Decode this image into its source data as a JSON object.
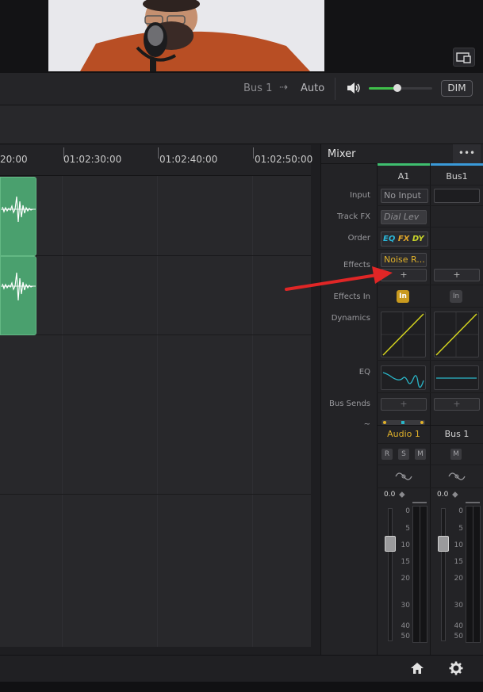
{
  "transport": {
    "bus_label": "Bus 1",
    "arrow": "⇢",
    "auto_label": "Auto",
    "dim_label": "DIM",
    "volume_level": 0.45
  },
  "timeline": {
    "ticks": [
      "20:00",
      "01:02:30:00",
      "01:02:40:00",
      "01:02:50:00"
    ]
  },
  "mixer": {
    "title": "Mixer",
    "menu_label": "•••",
    "row_labels": {
      "input": "Input",
      "track_fx": "Track FX",
      "order": "Order",
      "effects": "Effects",
      "effects_in": "Effects In",
      "dynamics": "Dynamics",
      "eq": "EQ",
      "bus_sends": "Bus Sends"
    },
    "channels": [
      {
        "header": "A1",
        "input": "No Input",
        "track_fx": "Dial Lev",
        "order": {
          "eq": "EQ",
          "fx": "FX",
          "dy": "DY"
        },
        "effect": "Noise R...",
        "add_effect": "+",
        "effects_in": "In",
        "bus_send": "+",
        "name": "Audio 1",
        "rsm": [
          "R",
          "S",
          "M"
        ],
        "fader_value": "0.0",
        "color": "#e0b12a"
      },
      {
        "header": "Bus1",
        "input": "",
        "track_fx": "",
        "effect": "",
        "add_effect": "+",
        "effects_in": "In",
        "bus_send": "+",
        "name": "Bus 1",
        "rsm": [
          "M"
        ],
        "fader_value": "0.0",
        "color": "#d6d6d6"
      }
    ],
    "scale": [
      "0",
      "5",
      "10",
      "15",
      "20",
      "30",
      "40",
      "50"
    ]
  },
  "colors": {
    "clip": "#4aa06e",
    "annotation_arrow": "#e02626",
    "volume_slider": "#3fbf4a",
    "a1_header_accent": "#3fbf6f",
    "bus1_header_accent": "#3a9ad9",
    "curve": "#d4d41f",
    "eq_line": "#2ab6c8"
  },
  "icons": {
    "screen": "screen-share-icon",
    "speaker": "speaker-icon",
    "home": "home-icon",
    "settings": "gear-icon",
    "phase": "phase-icon"
  }
}
